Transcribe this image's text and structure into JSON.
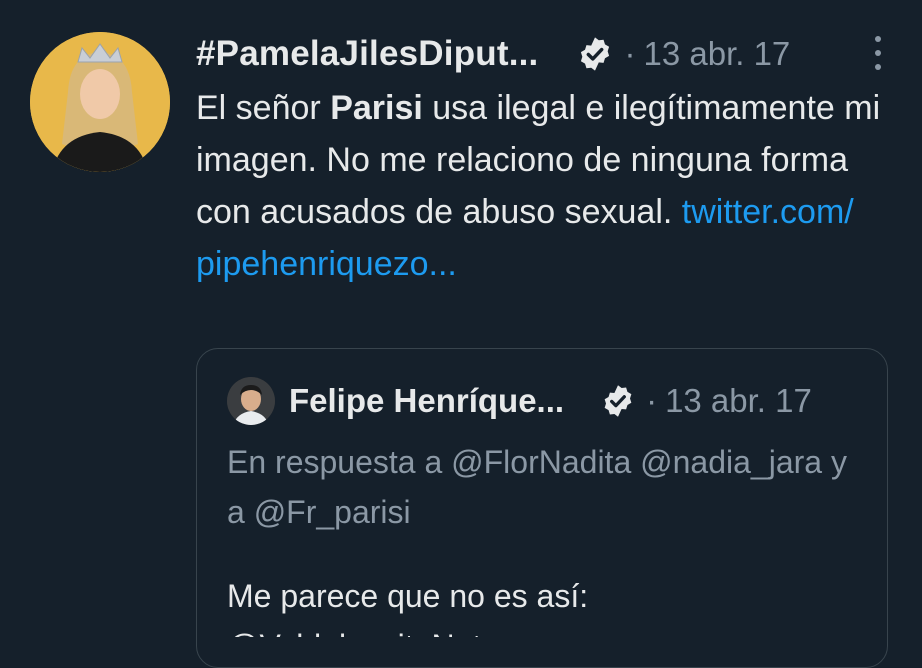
{
  "tweet": {
    "author_name": "#PamelaJilesDiput...",
    "separator": "·",
    "date": "13 abr. 17",
    "text_1": "El señor ",
    "text_bold": "Parisi",
    "text_2": " usa ilegal e ilegítimamente mi imagen. No me relaciono de ninguna forma con acusados de abuso sexual. ",
    "link_text": "twitter.com/ pipehenriquezo...",
    "more_icon": "more-vertical-icon",
    "verified_icon": "verified-badge-icon"
  },
  "quoted": {
    "author_name": "Felipe Henríque...",
    "separator": "·",
    "date": "13 abr. 17",
    "reply_to": "En respuesta a @FlorNadita @nadia_jara y a @Fr_parisi",
    "text": "Me parece que no es así:",
    "text_cut": "@ValdeluceitoNot..."
  },
  "colors": {
    "background": "#15202b",
    "text": "#e7e9ea",
    "muted": "#8b98a5",
    "link": "#1d9bf0",
    "border": "#38444d"
  }
}
